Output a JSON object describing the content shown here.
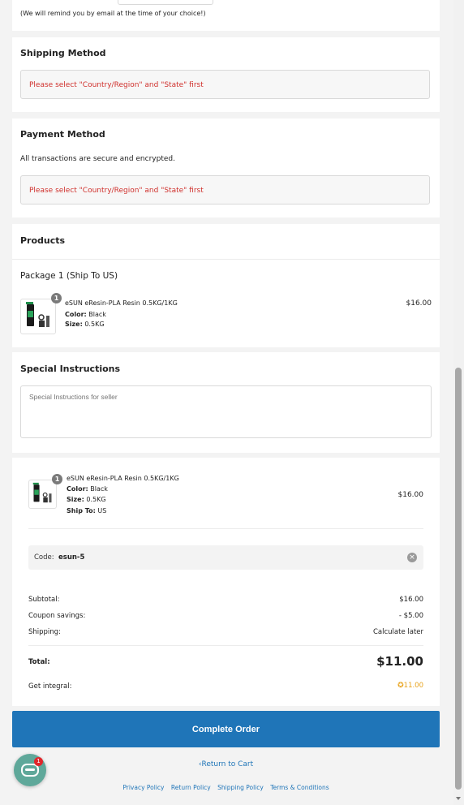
{
  "reminder_note": "(We will remind you by email at the time of your choice!)",
  "shipping": {
    "title": "Shipping Method",
    "notice": "Please select \"Country/Region\" and \"State\" first"
  },
  "payment": {
    "title": "Payment Method",
    "secure_text": "All transactions are secure and encrypted.",
    "notice": "Please select \"Country/Region\" and \"State\" first"
  },
  "products": {
    "title": "Products",
    "package_title": "Package 1 (Ship To US)",
    "item": {
      "qty": "1",
      "name": "eSUN eResin-PLA Resin 0.5KG/1KG",
      "color_label": "Color:",
      "color_value": "Black",
      "size_label": "Size:",
      "size_value": "0.5KG",
      "price": "$16.00"
    }
  },
  "special": {
    "title": "Special Instructions",
    "placeholder": "Special Instructions for seller"
  },
  "summary": {
    "item": {
      "qty": "1",
      "name": "eSUN eResin-PLA Resin 0.5KG/1KG",
      "color_label": "Color:",
      "color_value": "Black",
      "size_label": "Size:",
      "size_value": "0.5KG",
      "shipto_label": "Ship To:",
      "shipto_value": "US",
      "price": "$16.00"
    },
    "code_label": "Code:",
    "code_value": "esun-5",
    "subtotal_label": "Subtotal:",
    "subtotal_value": "$16.00",
    "coupon_label": "Coupon savings:",
    "coupon_value": "- $5.00",
    "shipping_label": "Shipping:",
    "shipping_value": "Calculate later",
    "total_label": "Total:",
    "total_value": "$11.00",
    "integral_label": "Get integral:",
    "integral_value": "11.00"
  },
  "complete_order": "Complete Order",
  "return_to_cart": "Return to Cart",
  "footer_links": [
    "Privacy Policy",
    "Return Policy",
    "Shipping Policy",
    "Terms & Conditions"
  ],
  "chat_badge": "1",
  "colors": {
    "accent": "#1f75b8",
    "error": "#d0312d",
    "integral": "#e8a21a",
    "chat": "#5fa89a"
  }
}
